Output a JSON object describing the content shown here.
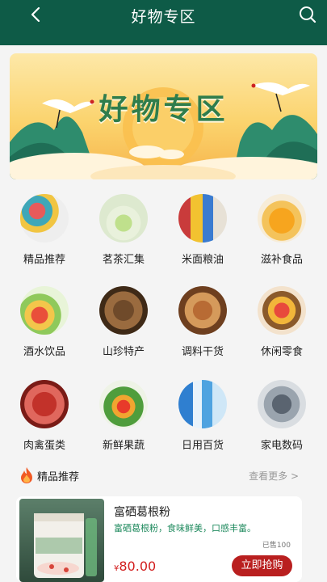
{
  "header": {
    "title": "好物专区",
    "background": "#0e5b47"
  },
  "banner": {
    "title": "好物专区"
  },
  "categories": [
    {
      "label": "精品推荐",
      "icon": "gift-boxes-icon"
    },
    {
      "label": "茗茶汇集",
      "icon": "tea-icon"
    },
    {
      "label": "米面粮油",
      "icon": "grain-oil-icon"
    },
    {
      "label": "滋补食品",
      "icon": "tonic-food-icon"
    },
    {
      "label": "酒水饮品",
      "icon": "drinks-icon"
    },
    {
      "label": "山珍特产",
      "icon": "mushroom-icon"
    },
    {
      "label": "调料干货",
      "icon": "dried-goods-icon"
    },
    {
      "label": "休闲零食",
      "icon": "snacks-icon"
    },
    {
      "label": "肉禽蛋类",
      "icon": "meat-icon"
    },
    {
      "label": "新鲜果蔬",
      "icon": "vegetables-icon"
    },
    {
      "label": "日用百货",
      "icon": "daily-goods-icon"
    },
    {
      "label": "家电数码",
      "icon": "appliances-icon"
    }
  ],
  "section": {
    "title": "精品推荐",
    "more": "查看更多 >"
  },
  "product": {
    "name": "富硒葛根粉",
    "description": "富硒葛根粉，食味鲜美，口感丰富。",
    "sold": "已售100",
    "price_symbol": "¥",
    "price": "80.00",
    "buy_label": "立即抢购",
    "image_label": "富硒葛根粉"
  },
  "colors": {
    "primary": "#0e5b47",
    "price": "#d21d1d",
    "button": "#b91f1f",
    "desc": "#1f8a5e"
  }
}
